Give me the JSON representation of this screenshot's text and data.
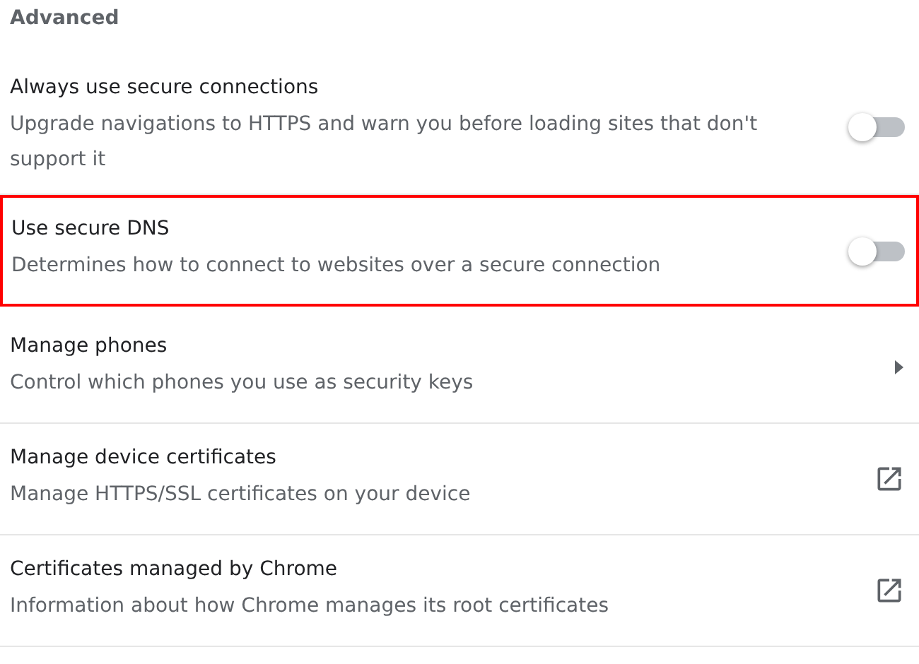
{
  "section_title": "Advanced",
  "items": [
    {
      "kind": "toggle",
      "title": "Always use secure connections",
      "description": "Upgrade navigations to HTTPS and warn you before loading sites that don't support it",
      "on": false,
      "highlighted": false
    },
    {
      "kind": "toggle",
      "title": "Use secure DNS",
      "description": "Determines how to connect to websites over a secure connection",
      "on": false,
      "highlighted": true
    },
    {
      "kind": "arrow",
      "title": "Manage phones",
      "description": "Control which phones you use as security keys",
      "highlighted": false
    },
    {
      "kind": "external",
      "title": "Manage device certificates",
      "description": "Manage HTTPS/SSL certificates on your device",
      "highlighted": false
    },
    {
      "kind": "external",
      "title": "Certificates managed by Chrome",
      "description": "Information about how Chrome manages its root certificates",
      "highlighted": false
    }
  ]
}
